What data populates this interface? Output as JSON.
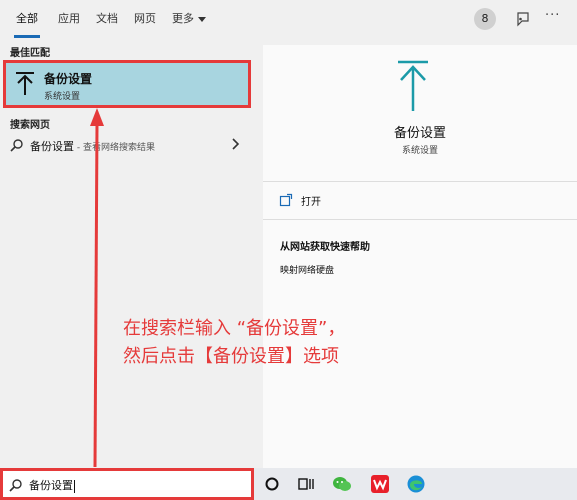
{
  "tabs": [
    {
      "label": "全部",
      "active": true
    },
    {
      "label": "应用"
    },
    {
      "label": "文档"
    },
    {
      "label": "网页"
    },
    {
      "label": "更多"
    }
  ],
  "header": {
    "points_badge": "8",
    "more_dots": "···"
  },
  "left": {
    "best_match_label": "最佳匹配",
    "best_match": {
      "title": "备份设置",
      "subtitle": "系统设置"
    },
    "web_label": "搜索网页",
    "web_result": {
      "query": "备份设置",
      "suffix": " - 查看网络搜索结果"
    }
  },
  "right": {
    "title": "备份设置",
    "subtitle": "系统设置",
    "open_label": "打开",
    "help_heading": "从网站获取快速帮助",
    "help_link": "映射网络硬盘"
  },
  "annotation": {
    "line1": "在搜索栏输入 “备份设置”，",
    "line2": "然后点击【备份设置】选项"
  },
  "search": {
    "value": "备份设置"
  },
  "colors": {
    "accent": "#1a6ab5",
    "highlight": "#a8d5e0",
    "annotation_red": "#e53a3a"
  }
}
